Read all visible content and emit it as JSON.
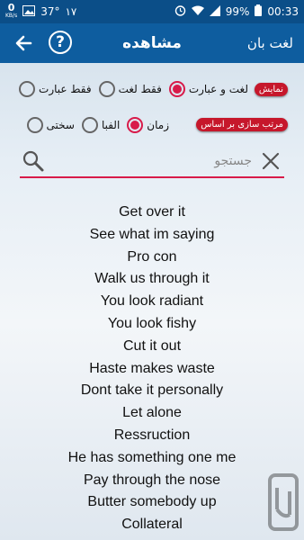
{
  "status_bar": {
    "net_speed_value": "0",
    "net_speed_unit": "KB/s",
    "temperature": "37°",
    "notif_count": "۱۷",
    "battery": "99%",
    "time": "00:33"
  },
  "app_bar": {
    "app_name": "لغت بان",
    "screen_title": "مشاهده",
    "help_label": "?"
  },
  "display_filter": {
    "pill_label": "نمایش",
    "options": [
      {
        "label": "لغت و عبارت",
        "selected": true
      },
      {
        "label": "فقط لغت",
        "selected": false
      },
      {
        "label": "فقط عبارت",
        "selected": false
      }
    ]
  },
  "sort_filter": {
    "pill_label": "مرتب سازی بر اساس",
    "options": [
      {
        "label": "زمان",
        "selected": true
      },
      {
        "label": "الفبا",
        "selected": false
      },
      {
        "label": "سختی",
        "selected": false
      }
    ]
  },
  "search": {
    "placeholder": "جستجو",
    "value": ""
  },
  "phrases": [
    "Get over it",
    "See what im saying",
    "Pro con",
    "Walk us through it",
    "You look radiant",
    "You look fishy",
    "Cut it out",
    "Haste makes waste",
    "Dont take it personally",
    "Let alone",
    "Ressruction",
    "He has something one me",
    "Pay through the nose",
    "Butter somebody up",
    "Collateral"
  ],
  "colors": {
    "status_bar": "#0b4e88",
    "app_bar": "#0e5d9f",
    "accent": "#d81b4a",
    "pill": "#c6172b"
  }
}
